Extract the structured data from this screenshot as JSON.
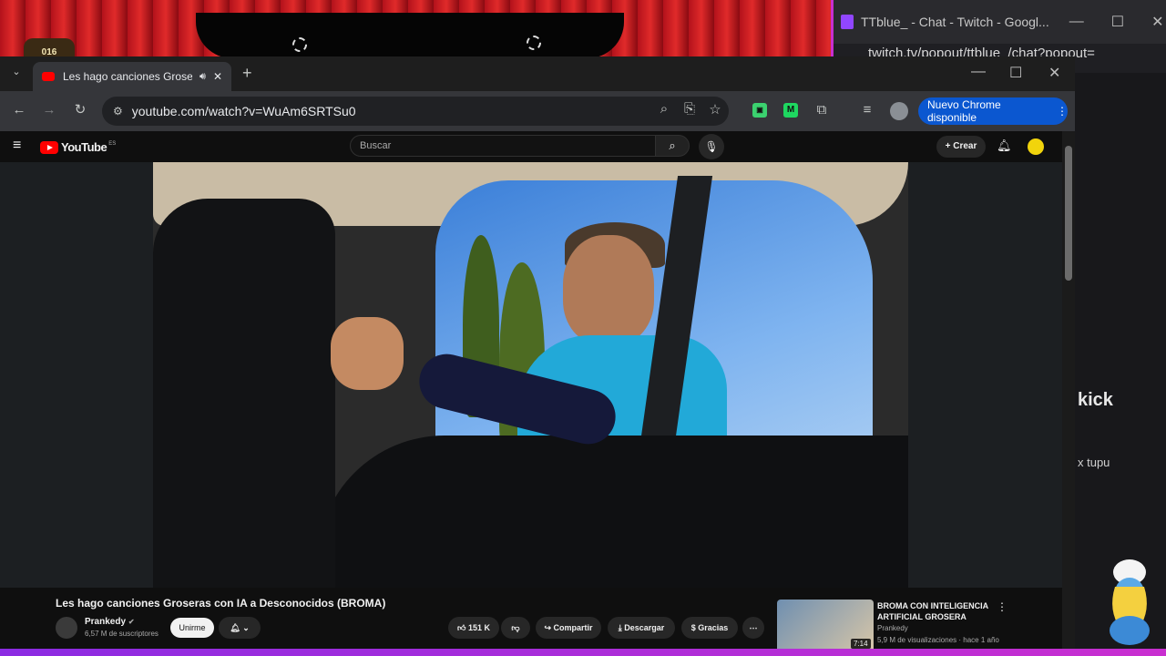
{
  "stream_overlay": {
    "badge_text": "016"
  },
  "twitch_window": {
    "title": "TTblue_ - Chat - Twitch - Googl...",
    "url": "twitch.tv/popout/ttblue_/chat?popout=",
    "chat_text_kick": "kick",
    "chat_text_tupu": "x tupu"
  },
  "chrome": {
    "tab_title": "Les hago canciones Grosera",
    "new_tab_symbol": "+",
    "address": "youtube.com/watch?v=WuAm6SRTSu0",
    "update_button": "Nuevo Chrome disponible"
  },
  "youtube": {
    "logo_text": "YouTube",
    "logo_region": "ES",
    "search_placeholder": "Buscar",
    "create_label": "Crear",
    "video_title": "Les hago canciones Groseras con IA a Desconocidos (BROMA)",
    "channel_name": "Prankedy",
    "subscribers": "6,57 M de suscriptores",
    "join_label": "Unirme",
    "likes": "151 K",
    "share_label": "Compartir",
    "download_label": "Descargar",
    "thanks_label": "Gracias",
    "recommended": {
      "title": "BROMA CON INTELIGENCIA ARTIFICIAL GROSERA",
      "channel": "Prankedy",
      "views": "5,9 M de visualizaciones · hace 1 año",
      "duration": "7:14"
    }
  },
  "colors": {
    "youtube_red": "#ff0000",
    "chrome_update_blue": "#0b57d0",
    "twitch_purple": "#9146ff"
  }
}
